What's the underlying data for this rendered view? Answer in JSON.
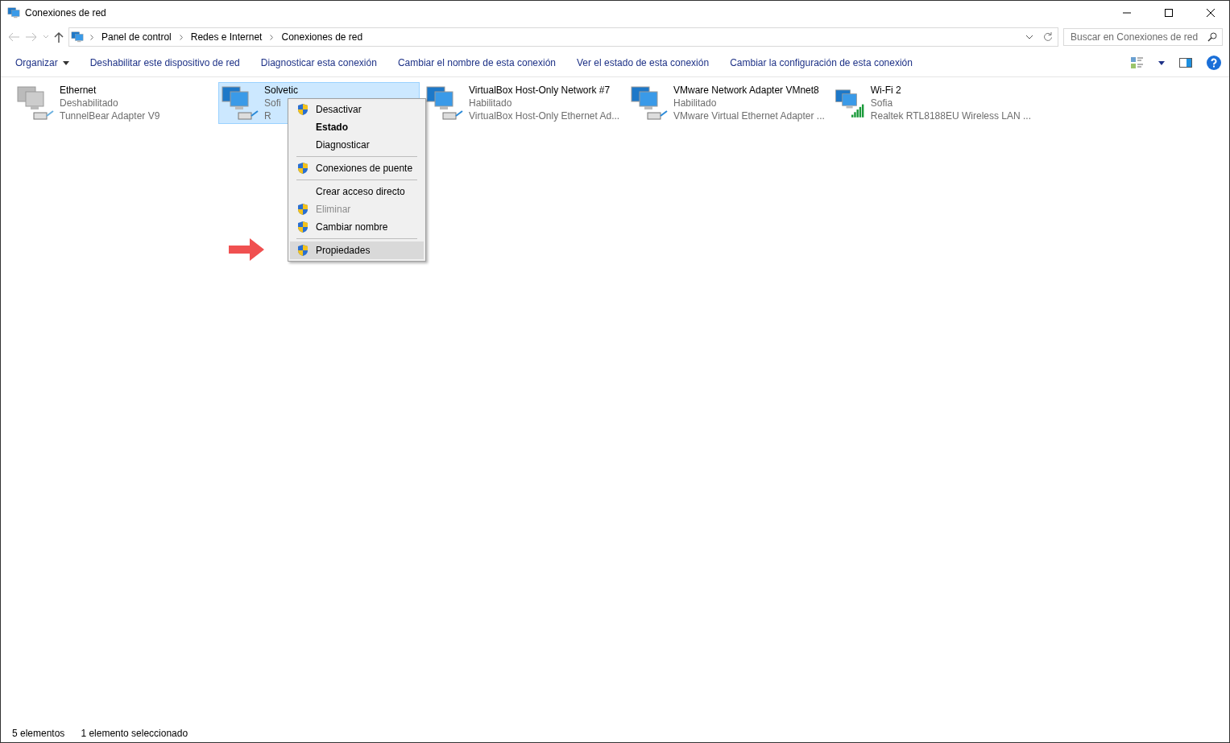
{
  "window": {
    "title": "Conexiones de red"
  },
  "address": {
    "breadcrumbs": [
      "Panel de control",
      "Redes e Internet",
      "Conexiones de red"
    ]
  },
  "search": {
    "placeholder": "Buscar en Conexiones de red"
  },
  "commands": [
    {
      "label": "Organizar",
      "dropdown": true
    },
    {
      "label": "Deshabilitar este dispositivo de red",
      "dropdown": false
    },
    {
      "label": "Diagnosticar esta conexión",
      "dropdown": false
    },
    {
      "label": "Cambiar el nombre de esta conexión",
      "dropdown": false
    },
    {
      "label": "Ver el estado de esta conexión",
      "dropdown": false
    },
    {
      "label": "Cambiar la configuración de esta conexión",
      "dropdown": false
    }
  ],
  "connections": [
    {
      "name": "Ethernet",
      "status": "Deshabilitado",
      "adapter": "TunnelBear Adapter V9",
      "kind": "cable",
      "disabled": true,
      "selected": false
    },
    {
      "name": "Solvetic",
      "status": "Sofi",
      "adapter": "R",
      "kind": "cable",
      "disabled": false,
      "selected": true
    },
    {
      "name": "VirtualBox Host-Only Network #7",
      "status": "Habilitado",
      "adapter": "VirtualBox Host-Only Ethernet Ad...",
      "kind": "cable",
      "disabled": false,
      "selected": false
    },
    {
      "name": "VMware Network Adapter VMnet8",
      "status": "Habilitado",
      "adapter": "VMware Virtual Ethernet Adapter ...",
      "kind": "cable",
      "disabled": false,
      "selected": false
    },
    {
      "name": "Wi-Fi 2",
      "status": "Sofia",
      "adapter": "Realtek RTL8188EU Wireless LAN ...",
      "kind": "wifi",
      "disabled": false,
      "selected": false
    }
  ],
  "context_menu": [
    {
      "kind": "item",
      "label": "Desactivar",
      "shield": true,
      "default": false,
      "disabled": false,
      "selected": false
    },
    {
      "kind": "item",
      "label": "Estado",
      "shield": false,
      "default": true,
      "disabled": false,
      "selected": false
    },
    {
      "kind": "item",
      "label": "Diagnosticar",
      "shield": false,
      "default": false,
      "disabled": false,
      "selected": false
    },
    {
      "kind": "separator"
    },
    {
      "kind": "item",
      "label": "Conexiones de puente",
      "shield": true,
      "default": false,
      "disabled": false,
      "selected": false
    },
    {
      "kind": "separator"
    },
    {
      "kind": "item",
      "label": "Crear acceso directo",
      "shield": false,
      "default": false,
      "disabled": false,
      "selected": false
    },
    {
      "kind": "item",
      "label": "Eliminar",
      "shield": true,
      "default": false,
      "disabled": true,
      "selected": false
    },
    {
      "kind": "item",
      "label": "Cambiar nombre",
      "shield": true,
      "default": false,
      "disabled": false,
      "selected": false
    },
    {
      "kind": "separator"
    },
    {
      "kind": "item",
      "label": "Propiedades",
      "shield": true,
      "default": false,
      "disabled": false,
      "selected": true
    }
  ],
  "status_bar": {
    "count": "5 elementos",
    "selection": "1 elemento seleccionado"
  }
}
